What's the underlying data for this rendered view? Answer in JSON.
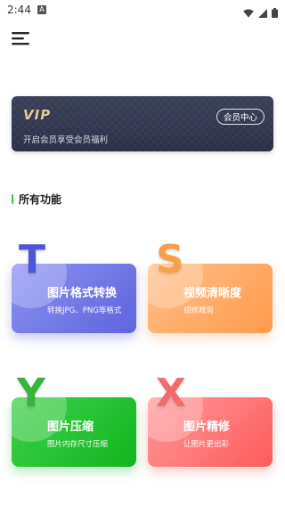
{
  "status_bar": {
    "time": "2:44",
    "notification_badge": "A",
    "icons": [
      "wifi-icon",
      "signal-icon",
      "battery-icon"
    ]
  },
  "header": {
    "menu_icon": "hamburger-menu-icon"
  },
  "vip_banner": {
    "logo": "VIP",
    "subtitle": "开启会员享受会员福利",
    "button_label": "会员中心"
  },
  "section": {
    "title": "所有功能",
    "accent_color": "#38c640"
  },
  "features": [
    {
      "letter": "T",
      "title": "图片格式转换",
      "description": "转换JPG、PNG等格式",
      "color": "#6a70e4"
    },
    {
      "letter": "S",
      "title": "视频清晰度",
      "description": "视频裁剪",
      "color": "#ffa35c"
    },
    {
      "letter": "Y",
      "title": "图片压缩",
      "description": "图片内存尺寸压缩",
      "color": "#1fbd2c"
    },
    {
      "letter": "X",
      "title": "图片精修",
      "description": "让图片更出彩",
      "color": "#ff6a6a"
    }
  ]
}
